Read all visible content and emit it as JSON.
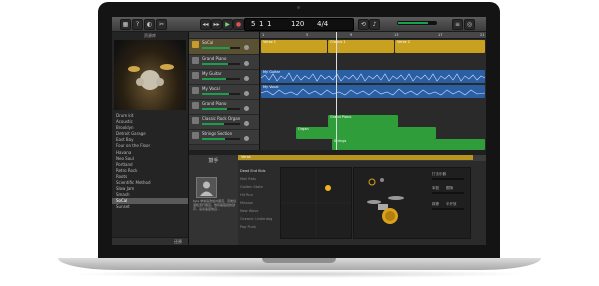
{
  "window": {
    "toolbar": {
      "lcd_bar": "5",
      "lcd_beat": "1",
      "lcd_ticks": "1",
      "lcd_tempo": "120",
      "lcd_sig": "4/4"
    },
    "library": {
      "title": "资源库",
      "items": [
        "Drum kit",
        "Acoustic",
        "Brooklyn",
        "Detroit Garage",
        "East Bay",
        "Four on the Floor",
        "Havana",
        "Neo Soul",
        "Portland",
        "Retro Rock",
        "Roots",
        "Scientific Method",
        "Slow Jam",
        "Smash",
        "SoCal",
        "Sunset"
      ],
      "selected_index": 14,
      "footer_label": "还原"
    },
    "tracks": [
      {
        "name": "SoCal",
        "selected": true
      },
      {
        "name": "Grand Piano"
      },
      {
        "name": "My Guitar"
      },
      {
        "name": "My Vocal"
      },
      {
        "name": "Grand Piano"
      },
      {
        "name": "Classic Rock Organ"
      },
      {
        "name": "Strings Section"
      }
    ],
    "ruler_ticks": [
      "1",
      "5",
      "9",
      "13",
      "17",
      "21"
    ],
    "regions": [
      {
        "track": 0,
        "label": "Verse 1"
      },
      {
        "track": 0,
        "label": "Chorus 1"
      },
      {
        "track": 0,
        "label": "Verse 2"
      },
      {
        "track": 2,
        "label": "My Guitar"
      },
      {
        "track": 3,
        "label": "My Vocal"
      },
      {
        "track": 4,
        "label": "Grand Piano"
      },
      {
        "track": 5,
        "label": "Organ"
      },
      {
        "track": 6,
        "label": "Strings"
      }
    ],
    "smart_controls": {
      "title": "鼓手",
      "description": "Kyle 非常喜欢加州朋克、另类摇滚和流行朋克。他有着强劲的鼓声，演奏速度快且..."
    },
    "drummer_editor": {
      "region_label": "Verse",
      "presets": [
        "Dead End Kids",
        "Mall Rats",
        "Golden State",
        "Hit Run",
        "Mission",
        "New Wave",
        "Oceanic Underdog",
        "Pop Punk"
      ],
      "selected_preset": 0,
      "controls": [
        "打击乐器",
        "军鼓",
        "跟随",
        "踩镲",
        "半开放"
      ]
    }
  }
}
